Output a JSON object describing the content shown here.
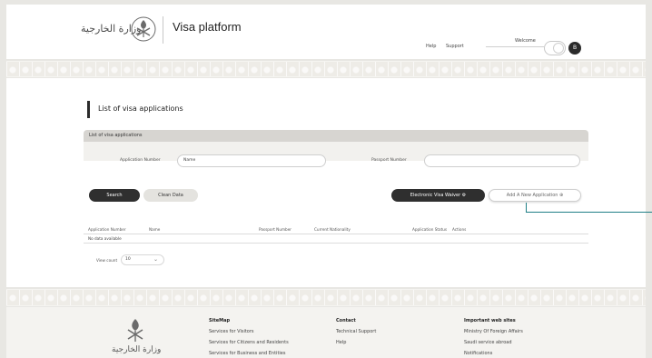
{
  "header": {
    "logo_text": "وزارة الخارجية",
    "title": "Visa platform",
    "help": "Help",
    "support": "Support",
    "welcome": "Welcome",
    "user_initial": "B"
  },
  "main": {
    "section_title": "List of visa applications",
    "panel_title": "List of visa applications",
    "application_number_label": "Application Number",
    "application_number_value": "Name",
    "passport_number_label": "Passport Number",
    "passport_number_placeholder": "",
    "search_button": "Search",
    "clean_button": "Clean Data",
    "evisa_waiver_button": "Electronic Visa Waiver ⚙",
    "add_application_button": "Add A New Application ⊕",
    "table": {
      "columns": [
        "Application Number",
        "Name",
        "Passport Number",
        "Current Nationality",
        "Application Status",
        "Actions"
      ],
      "empty_message": "No data available"
    },
    "view_count_label": "View count",
    "view_count_value": "10",
    "view_count_arrow": "⌄"
  },
  "footer": {
    "logo_text": "وزارة الخارجية",
    "columns": [
      {
        "heading": "SiteMap",
        "links": [
          "Services for Visitors",
          "Services for Citizens and Residents",
          "Services for Business and Entities"
        ]
      },
      {
        "heading": "Contact",
        "links": [
          "Technical Support",
          "Help"
        ]
      },
      {
        "heading": "Important web sites",
        "links": [
          "Ministry Of Foreign Affairs",
          "Saudi service abroad",
          "Notifications"
        ]
      }
    ]
  },
  "colors": {
    "dark_button": "#2f2f2f",
    "callout_line": "#1f7f86",
    "background": "#e8e7e3"
  }
}
